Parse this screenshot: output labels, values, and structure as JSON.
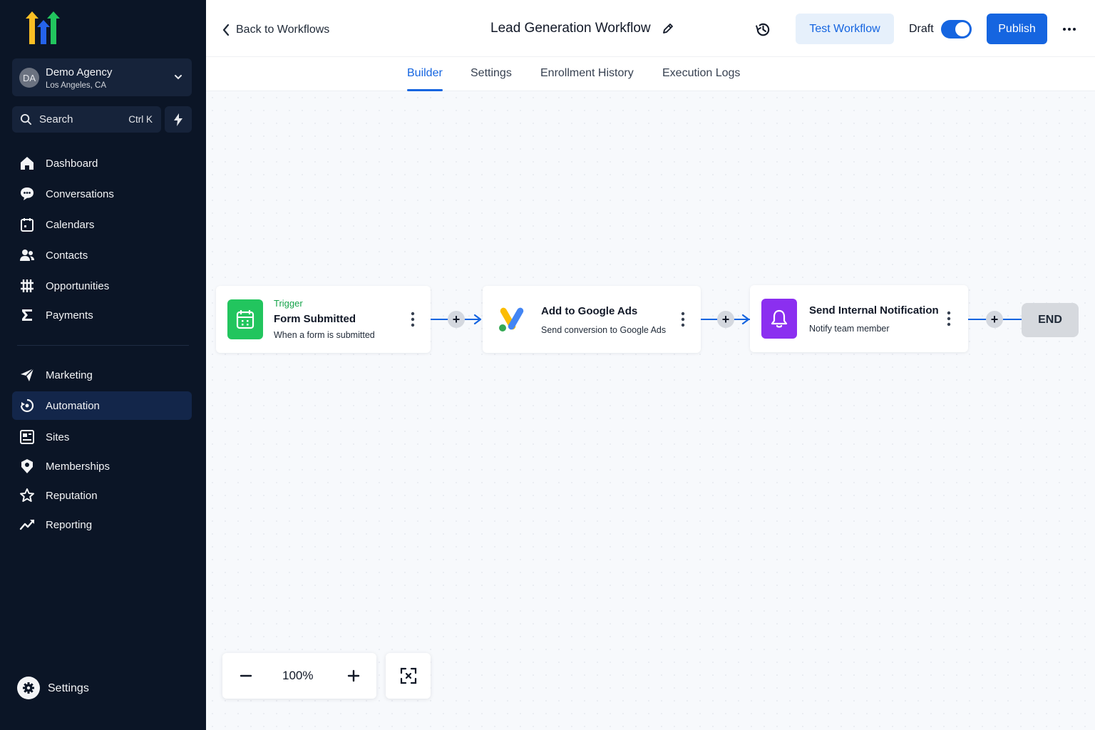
{
  "sidebar": {
    "account": {
      "initials": "DA",
      "name": "Demo Agency",
      "location": "Los Angeles, CA"
    },
    "search": {
      "label": "Search",
      "shortcut": "Ctrl K"
    },
    "nav_primary": [
      {
        "label": "Dashboard",
        "icon": "home-icon"
      },
      {
        "label": "Conversations",
        "icon": "chat-icon"
      },
      {
        "label": "Calendars",
        "icon": "calendar-icon"
      },
      {
        "label": "Contacts",
        "icon": "contacts-icon"
      },
      {
        "label": "Opportunities",
        "icon": "opportunities-icon"
      },
      {
        "label": "Payments",
        "icon": "payments-icon"
      }
    ],
    "nav_secondary": [
      {
        "label": "Marketing",
        "icon": "send-icon"
      },
      {
        "label": "Automation",
        "icon": "automation-icon",
        "active": true
      },
      {
        "label": "Sites",
        "icon": "sites-icon"
      },
      {
        "label": "Memberships",
        "icon": "membership-icon"
      },
      {
        "label": "Reputation",
        "icon": "star-icon"
      },
      {
        "label": "Reporting",
        "icon": "trend-icon"
      }
    ],
    "settings_label": "Settings"
  },
  "header": {
    "back_label": "Back to Workflows",
    "title": "Lead Generation Workflow",
    "test_label": "Test Workflow",
    "draft_label": "Draft",
    "draft_toggle_on": true,
    "publish_label": "Publish"
  },
  "tabs": [
    {
      "label": "Builder",
      "active": true
    },
    {
      "label": "Settings"
    },
    {
      "label": "Enrollment History"
    },
    {
      "label": "Execution Logs"
    }
  ],
  "workflow": {
    "nodes": [
      {
        "kicker": "Trigger",
        "title": "Form Submitted",
        "subtitle": "When a form is submitted",
        "icon": "form-calendar-icon",
        "icon_color": "#22c55e"
      },
      {
        "kicker": "",
        "title": "Add to Google Ads",
        "subtitle": "Send conversion to Google Ads",
        "icon": "google-ads-icon"
      },
      {
        "kicker": "",
        "title": "Send Internal Notification",
        "subtitle": "Notify team member",
        "icon": "bell-icon",
        "icon_color": "#8b2ff0"
      }
    ],
    "end_label": "END"
  },
  "zoom": {
    "level": "100%"
  },
  "colors": {
    "accent": "#1565e0",
    "sidebar_bg": "#0b1526",
    "trigger_green": "#16a34a"
  }
}
